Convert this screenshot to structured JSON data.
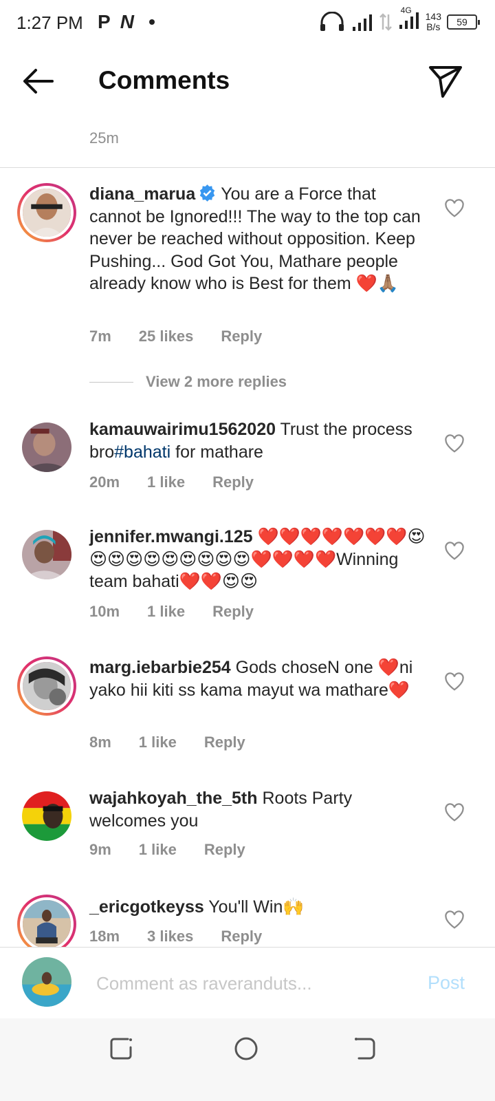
{
  "status_bar": {
    "time": "1:27 PM",
    "left_icons": [
      "P",
      "N"
    ],
    "network": "4G",
    "net_speed_value": "143",
    "net_speed_unit": "B/s",
    "battery": "59"
  },
  "header": {
    "title": "Comments",
    "back_icon": "arrow-left-icon",
    "send_icon": "paper-plane-icon"
  },
  "caption_time": "25m",
  "comments": [
    {
      "username": "diana_marua",
      "verified": true,
      "text": "You are a Force that cannot be Ignored!!! The way to the top can never be reached without opposition. Keep Pushing... God Got You, Mathare people already know who is Best for them ❤️🙏🏽",
      "time": "7m",
      "likes": "25 likes",
      "reply": "Reply",
      "story_ring": true
    },
    {
      "username": "kamauwairimu1562020",
      "text_before": "Trust the process bro",
      "hashtag": "#bahati",
      "text_after": " for mathare",
      "time": "20m",
      "likes": "1 like",
      "reply": "Reply",
      "story_ring": false
    },
    {
      "username": "jennifer.mwangi.125",
      "text": "❤️❤️❤️❤️❤️❤️❤️😍😍😍😍😍😍😍😍😍😍❤️❤️❤️❤️Winning team bahati❤️❤️😍😍",
      "time": "10m",
      "likes": "1 like",
      "reply": "Reply",
      "story_ring": false
    },
    {
      "username": "marg.iebarbie254",
      "text": "Gods choseN one ❤️ni yako hii kiti ss kama mayut wa mathare❤️",
      "time": "8m",
      "likes": "1 like",
      "reply": "Reply",
      "story_ring": true
    },
    {
      "username": "wajahkoyah_the_5th",
      "text": "Roots Party welcomes you",
      "time": "9m",
      "likes": "1 like",
      "reply": "Reply",
      "story_ring": false
    },
    {
      "username": "_ericgotkeyss",
      "text": "You'll Win🙌",
      "time": "18m",
      "likes": "3 likes",
      "reply": "Reply",
      "story_ring": true
    }
  ],
  "view_replies": "View 2 more replies",
  "comment_bar": {
    "placeholder": "Comment as raveranduts...",
    "post_label": "Post"
  },
  "nav_bar": {
    "icons": [
      "recents-icon",
      "home-icon",
      "back-icon"
    ]
  },
  "colors": {
    "link": "#00376b",
    "muted": "#8e8e8e",
    "verified": "#3897f0",
    "post_disabled": "#b2dffc",
    "heart_red": "#ed4956"
  }
}
